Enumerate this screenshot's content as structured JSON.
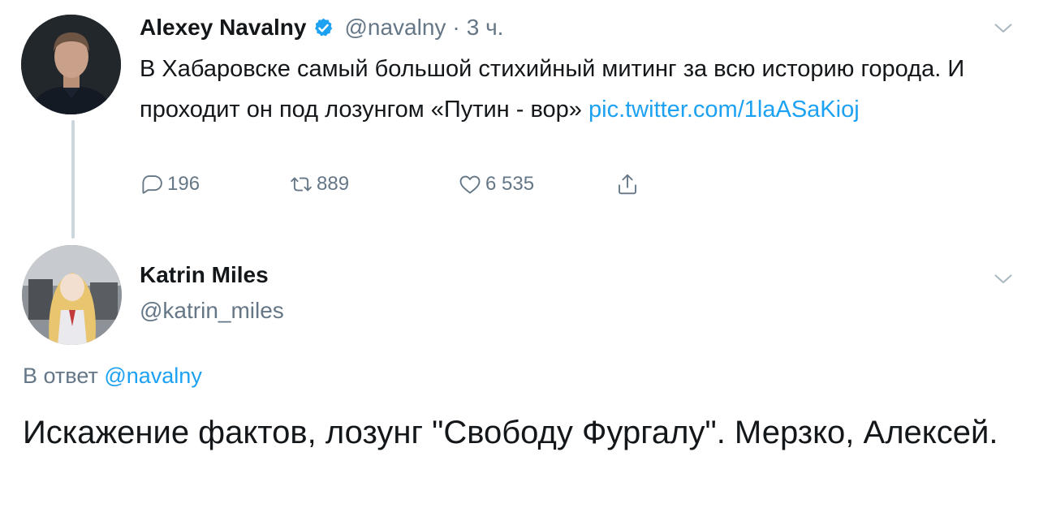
{
  "tweet1": {
    "name": "Alexey Navalny",
    "handle": "@navalny",
    "separator": "·",
    "time": "3 ч.",
    "text_before_link": "В Хабаровске самый большой стихийный митинг за всю историю города. И проходит он под лозунгом «Путин - вор» ",
    "link_text": "pic.twitter.com/1laASaKioj",
    "actions": {
      "reply_count": "196",
      "retweet_count": "889",
      "like_count": "6 535"
    }
  },
  "tweet2": {
    "name": "Katrin Miles",
    "handle": "@katrin_miles",
    "replying_to_label": "В ответ",
    "replying_to_handle": "@navalny",
    "text": "Искажение фактов, лозунг \"Свободу Фургалу\". Мерзко, Алексей."
  },
  "colors": {
    "link": "#1da1f2",
    "secondary": "#657786",
    "text": "#14171a",
    "thread_line": "#ccd6dd"
  },
  "icons": [
    "verified-badge-icon",
    "chevron-down-icon",
    "reply-icon",
    "retweet-icon",
    "like-icon",
    "share-icon"
  ]
}
